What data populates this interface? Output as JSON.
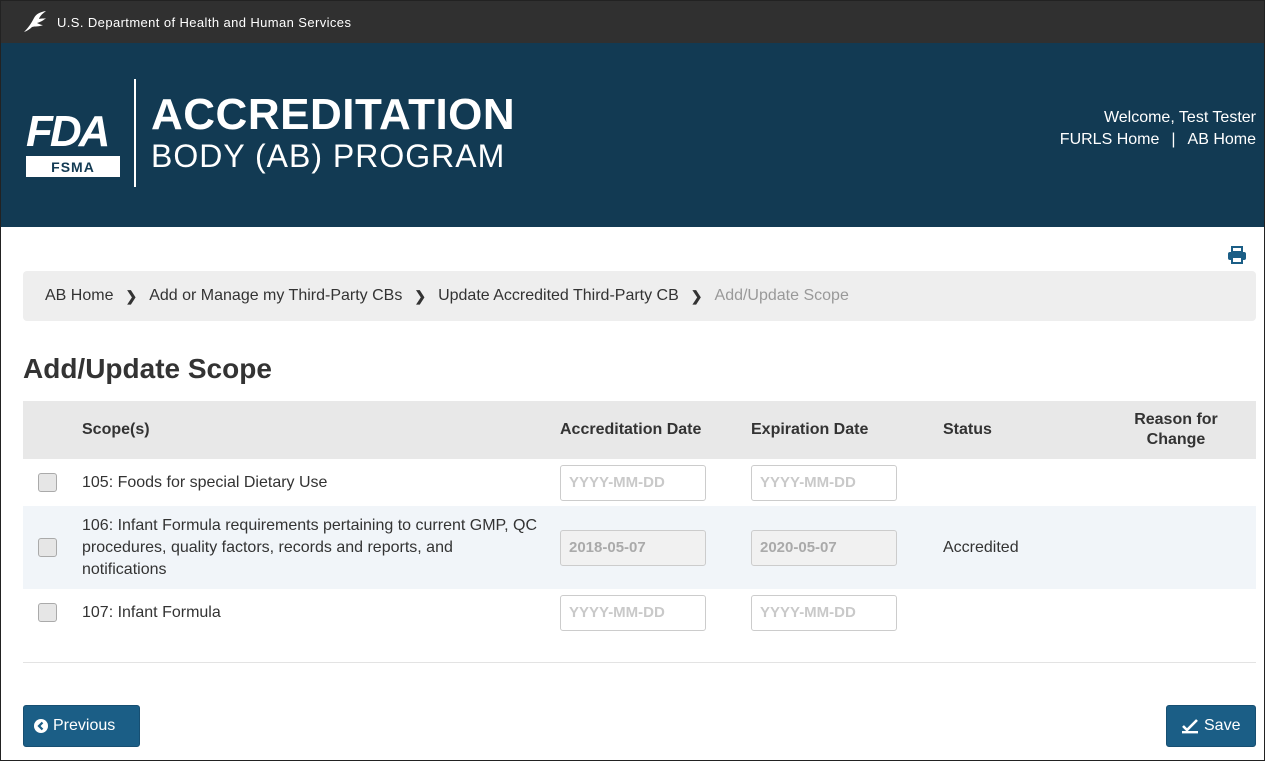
{
  "topbar": {
    "agency": "U.S. Department of Health and Human Services"
  },
  "logo": {
    "fda": "FDA",
    "fsma": "FSMA"
  },
  "program": {
    "line1": "ACCREDITATION",
    "line2": "BODY (AB) PROGRAM"
  },
  "user": {
    "welcome": "Welcome, Test Tester",
    "furls_home": "FURLS Home",
    "separator": "|",
    "ab_home": "AB Home"
  },
  "breadcrumb": [
    "AB Home",
    "Add or Manage my Third-Party CBs",
    "Update Accredited Third-Party CB",
    "Add/Update Scope"
  ],
  "page": {
    "title": "Add/Update Scope"
  },
  "table": {
    "headers": {
      "scope": "Scope(s)",
      "accreditation_date": "Accreditation Date",
      "expiration_date": "Expiration Date",
      "status": "Status",
      "reason_line1": "Reason for",
      "reason_line2": "Change"
    },
    "date_placeholder": "YYYY-MM-DD",
    "rows": [
      {
        "scope": "105: Foods for special Dietary Use",
        "accreditation_date": "",
        "expiration_date": "",
        "status": "",
        "reason": ""
      },
      {
        "scope": "106: Infant Formula requirements pertaining to current GMP, QC procedures, quality factors, records and reports, and notifications",
        "accreditation_date": "2018-05-07",
        "expiration_date": "2020-05-07",
        "status": "Accredited",
        "reason": ""
      },
      {
        "scope": "107: Infant Formula",
        "accreditation_date": "",
        "expiration_date": "",
        "status": "",
        "reason": ""
      }
    ]
  },
  "buttons": {
    "previous": "Previous",
    "save": "Save"
  },
  "colors": {
    "topbar": "#303030",
    "banner": "#123a53",
    "button": "#1b5e86",
    "breadcrumb_bg": "#eeeeee"
  },
  "icons": {
    "agency": "hhs-eagle-icon",
    "print": "print-icon",
    "previous": "chevron-circle-left-icon",
    "save": "check-square-icon"
  }
}
